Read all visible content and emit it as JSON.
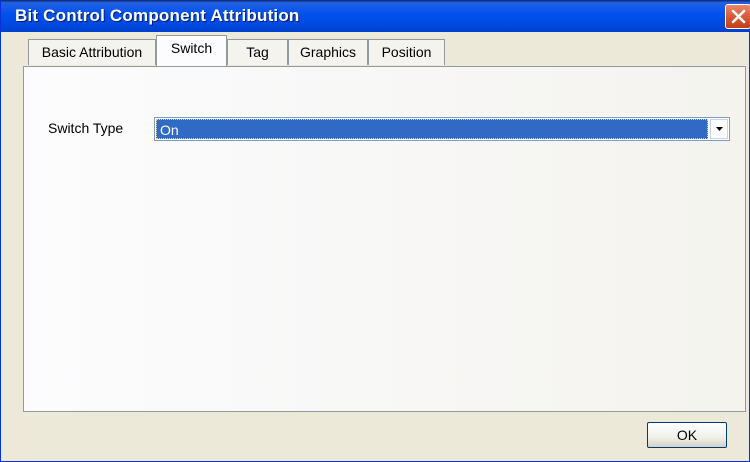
{
  "window": {
    "title": "Bit Control Component Attribution"
  },
  "tabs": [
    {
      "label": "Basic Attribution",
      "active": false
    },
    {
      "label": "Switch",
      "active": true
    },
    {
      "label": "Tag",
      "active": false
    },
    {
      "label": "Graphics",
      "active": false
    },
    {
      "label": "Position",
      "active": false
    }
  ],
  "switch_panel": {
    "switch_type_label": "Switch Type",
    "switch_type_value": "On"
  },
  "buttons": {
    "ok_label": "OK"
  },
  "icons": {
    "close": "close-icon",
    "dropdown": "chevron-down-icon"
  },
  "colors": {
    "titlebar": "#0050ee",
    "selection": "#316ac5",
    "close_button": "#d95b36"
  }
}
